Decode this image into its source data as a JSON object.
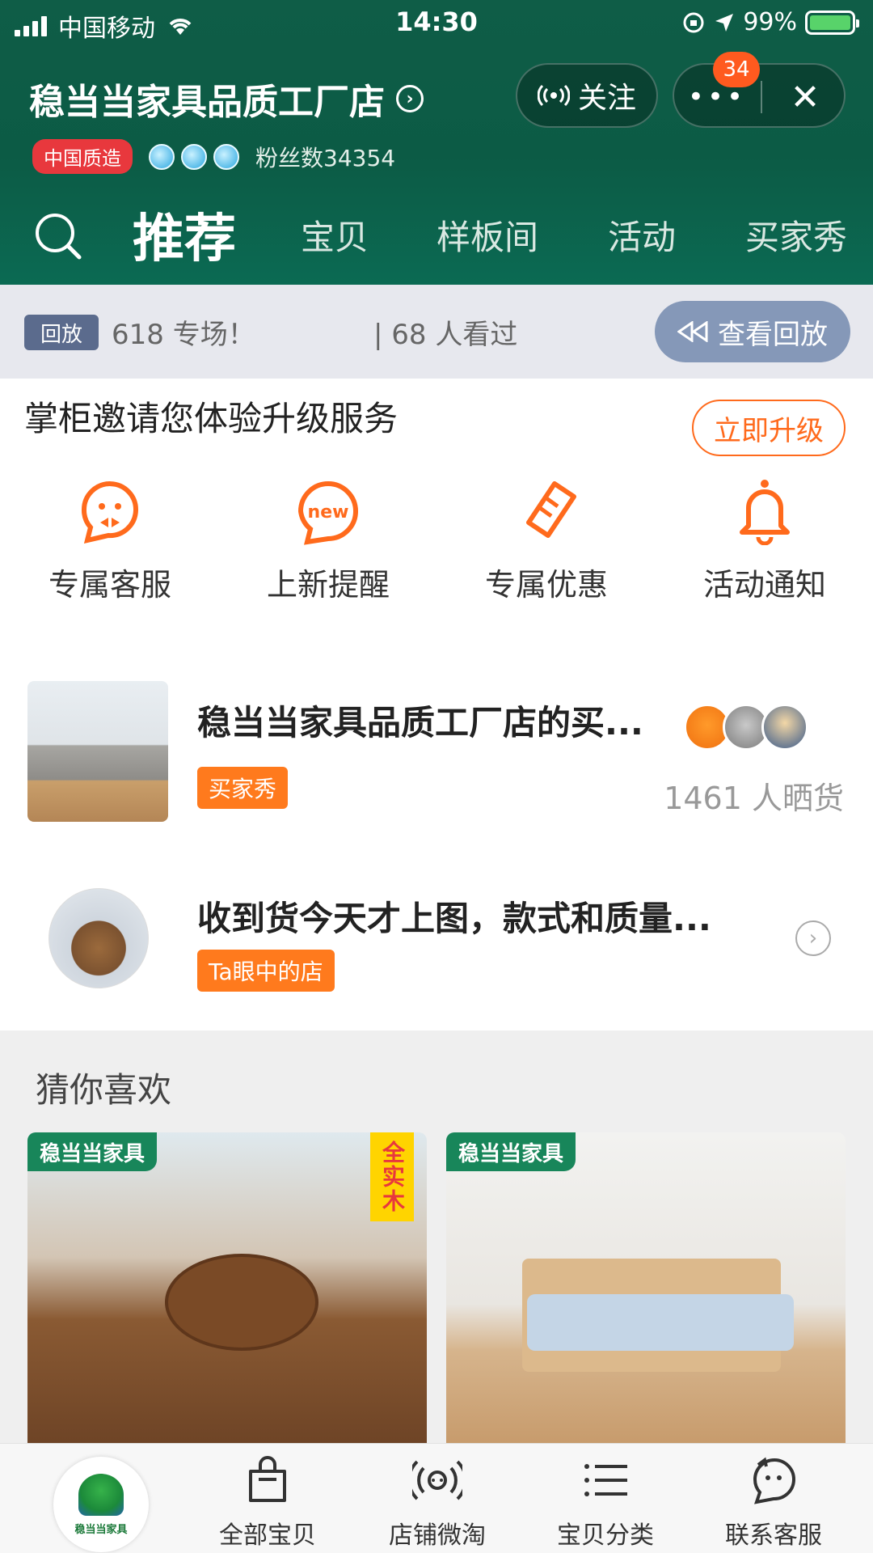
{
  "status_bar": {
    "carrier": "中国移动",
    "time": "14:30",
    "battery": "99%"
  },
  "header": {
    "shop_name": "稳当当家具品质工厂店",
    "follow_label": "关注",
    "more_label": "•••",
    "notification_count": "34",
    "close_label": "✕",
    "quality_tag": "中国质造",
    "fans": "粉丝数34354"
  },
  "tabs": [
    {
      "label": "推荐",
      "active": true
    },
    {
      "label": "宝贝"
    },
    {
      "label": "样板间"
    },
    {
      "label": "活动"
    },
    {
      "label": "买家秀"
    }
  ],
  "live": {
    "tag": "回放",
    "title": "618 专场！",
    "views": "| 68 人看过",
    "button": "查看回放"
  },
  "upgrade": {
    "title": "掌柜邀请您体验升级服务",
    "button": "立即升级",
    "services": [
      {
        "icon": "customer-service-icon",
        "label": "专属客服"
      },
      {
        "icon": "new-arrival-icon",
        "label": "上新提醒"
      },
      {
        "icon": "coupon-icon",
        "label": "专属优惠"
      },
      {
        "icon": "bell-icon",
        "label": "活动通知"
      }
    ]
  },
  "buyer_show": {
    "title": "稳当当家具品质工厂店的买...",
    "tag": "买家秀",
    "count": "1461 人晒货"
  },
  "review": {
    "title": "收到货今天才上图，款式和质量...",
    "tag": "Ta眼中的店"
  },
  "guess": {
    "title": "猜你喜欢",
    "products": [
      {
        "brand": "稳当当家具",
        "badge": "全实木"
      },
      {
        "brand": "稳当当家具"
      }
    ]
  },
  "bottom_nav": [
    {
      "icon": "bag-icon",
      "label": "全部宝贝"
    },
    {
      "icon": "broadcast-icon",
      "label": "店铺微淘"
    },
    {
      "icon": "list-icon",
      "label": "宝贝分类"
    },
    {
      "icon": "chat-icon",
      "label": "联系客服"
    }
  ],
  "logo_text": "稳当当家具",
  "colors": {
    "header_green": "#0c5b45",
    "accent_orange": "#ff7a1d",
    "brand_green": "#18865a"
  }
}
